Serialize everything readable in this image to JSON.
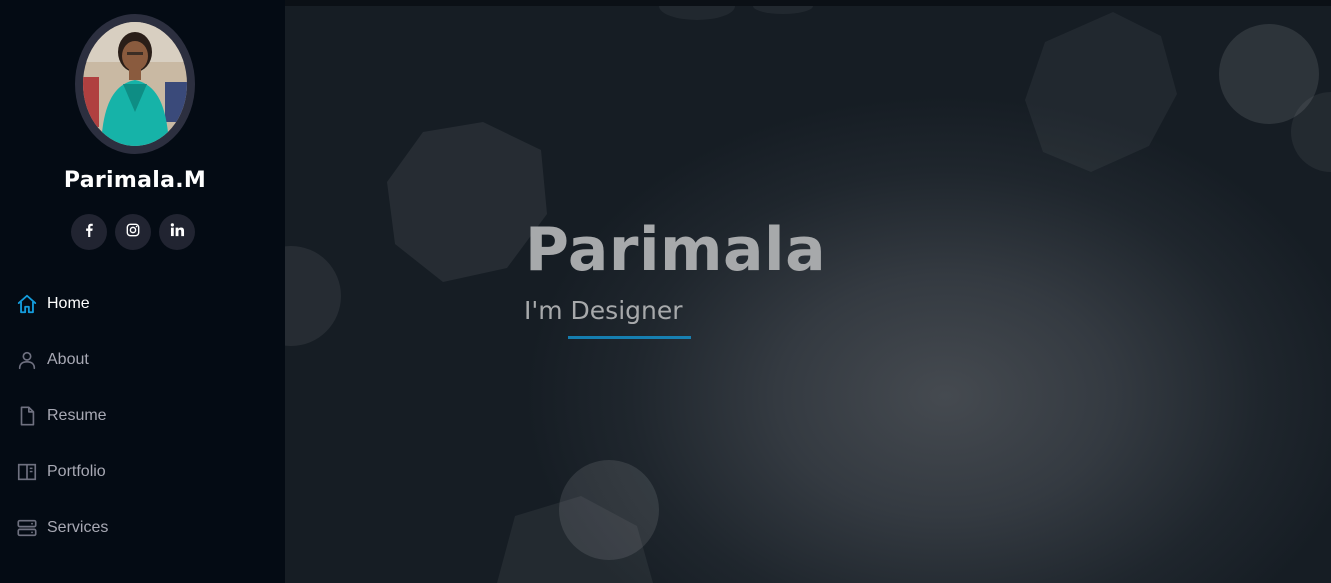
{
  "profile": {
    "name": "Parimala.M"
  },
  "social": [
    {
      "icon": "facebook-icon",
      "glyph": "f"
    },
    {
      "icon": "instagram-icon",
      "glyph": ""
    },
    {
      "icon": "linkedin-icon",
      "glyph": "in"
    }
  ],
  "nav": {
    "items": [
      {
        "label": "Home",
        "icon": "home-icon",
        "active": true
      },
      {
        "label": "About",
        "icon": "person-icon",
        "active": false
      },
      {
        "label": "Resume",
        "icon": "file-icon",
        "active": false
      },
      {
        "label": "Portfolio",
        "icon": "book-half-icon",
        "active": false
      },
      {
        "label": "Services",
        "icon": "server-icon",
        "active": false
      }
    ]
  },
  "hero": {
    "title": "Parimala",
    "subtitle": "I'm Designer"
  },
  "colors": {
    "accent": "#149ddd",
    "sidebar_bg": "#040b14",
    "nav_text": "#a8a9b4"
  }
}
